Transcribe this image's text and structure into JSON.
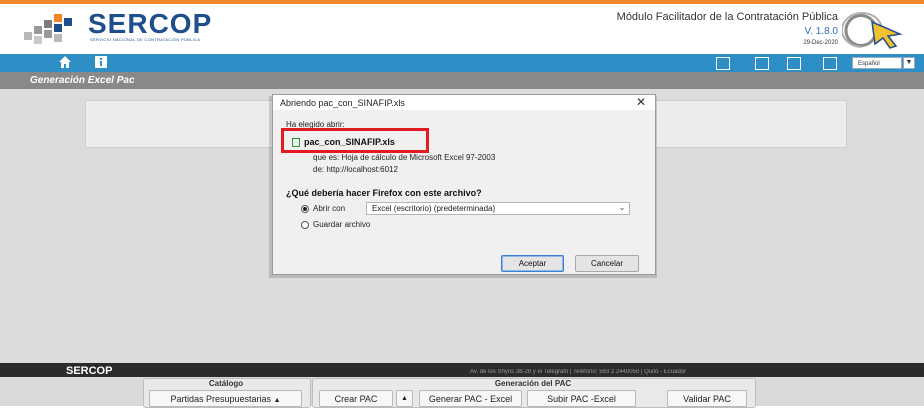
{
  "header": {
    "logo_text": "SERCOP",
    "logo_subtitle": "SERVICIO NACIONAL DE CONTRATACIÓN PÚBLICA",
    "module_title": "Módulo Facilitador de la Contratación Pública",
    "version": "V. 1.8.0",
    "date": "29-Dec-2020"
  },
  "nav": {
    "home_icon": "home-icon",
    "info_icon": "info-icon",
    "language": "Español"
  },
  "section": {
    "title": "Generación Excel Pac"
  },
  "dialog": {
    "title": "Abriendo pac_con_SINAFIP.xls",
    "chosen_label": "Ha elegido abrir:",
    "file_name": "pac_con_SINAFIP.xls",
    "file_type": "que es:  Hoja de cálculo de Microsoft Excel 97-2003",
    "file_source": "de:  http://localhost:6012",
    "question": "¿Qué debería hacer Firefox con este archivo?",
    "open_with_label": "Abrir con",
    "open_with_app": "Excel (escritorio) (predeterminada)",
    "save_label": "Guardar archivo",
    "accept_label": "Aceptar",
    "cancel_label": "Cancelar"
  },
  "footer": {
    "logo_text": "SERCOP",
    "text": "Av. de los Shyris 38-28 y el Telégrafo | Teléfono: 593 2 2440050 | Quito - Ecuador"
  },
  "toolbar": {
    "catalog": {
      "title": "Catálogo",
      "partidas_label": "Partidas Presupuestarias"
    },
    "pac": {
      "title": "Generación del PAC",
      "crear_label": "Crear PAC",
      "generar_label": "Generar PAC - Excel",
      "subir_label": "Subir PAC -Excel",
      "validar_label": "Validar PAC"
    }
  },
  "colors": {
    "accent_orange": "#f0882a",
    "nav_blue": "#2e8fc7",
    "highlight_red": "#e21b23",
    "brand_navy": "#1f4e8c"
  }
}
